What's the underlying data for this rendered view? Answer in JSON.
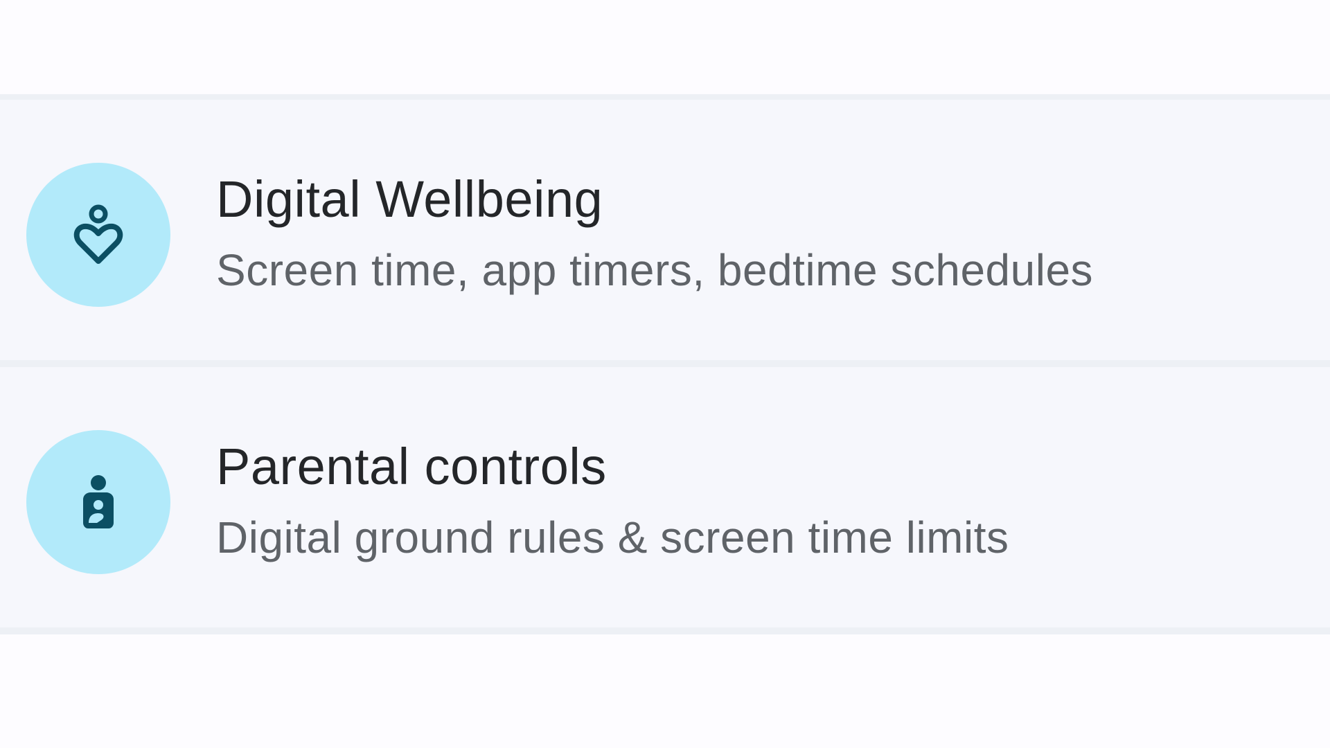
{
  "settings": {
    "items": [
      {
        "title": "Digital Wellbeing",
        "subtitle": "Screen time, app timers, bedtime schedules",
        "icon": "wellbeing-heart-person-icon"
      },
      {
        "title": "Parental controls",
        "subtitle": "Digital ground rules & screen time limits",
        "icon": "parental-controls-child-icon"
      }
    ]
  },
  "colors": {
    "background": "#fdfcff",
    "row_background": "#f6f7fc",
    "divider": "#edf0f5",
    "icon_circle": "#b2eafa",
    "icon_glyph": "#0b4f63",
    "title_text": "#242629",
    "subtitle_text": "#5f6368"
  }
}
